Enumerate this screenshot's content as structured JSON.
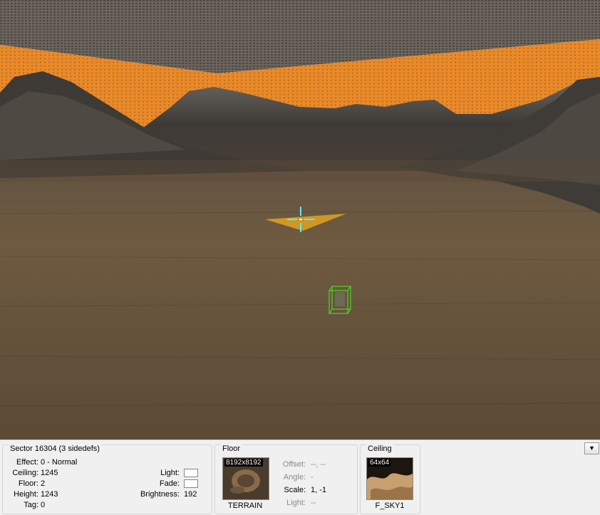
{
  "sector_info": {
    "title": "Sector 16304 (3 sidedefs)",
    "effect_label": "Effect:",
    "effect_value": "0 - Normal",
    "ceiling_label": "Ceiling:",
    "ceiling_value": "1245",
    "floor_label": "Floor:",
    "floor_value": "2",
    "height_label": "Height:",
    "height_value": "1243",
    "tag_label": "Tag:",
    "tag_value": "0",
    "light_label": "Light:",
    "fade_label": "Fade:",
    "brightness_label": "Brightness:",
    "brightness_value": "192"
  },
  "floor_panel": {
    "title": "Floor",
    "texture_size": "8192x8192",
    "texture_name": "TERRAIN",
    "offset_label": "Offset:",
    "offset_value": "--, --",
    "angle_label": "Angle:",
    "angle_value": "-",
    "scale_label": "Scale:",
    "scale_value": "1, -1",
    "light_label": "Light:",
    "light_value": "--"
  },
  "ceiling_panel": {
    "title": "Ceiling",
    "texture_size": "64x64",
    "texture_name": "F_SKY1"
  },
  "collapse_button": {
    "icon": "▼"
  },
  "colors": {
    "wall_orange": "#e68a2a",
    "ceiling_gray": "#5f5a54",
    "ground_brown": "#6e5a40",
    "highlight_plane": "#d9a020",
    "crosshair": "#5fe6ff",
    "thing_box": "#44ee22"
  }
}
